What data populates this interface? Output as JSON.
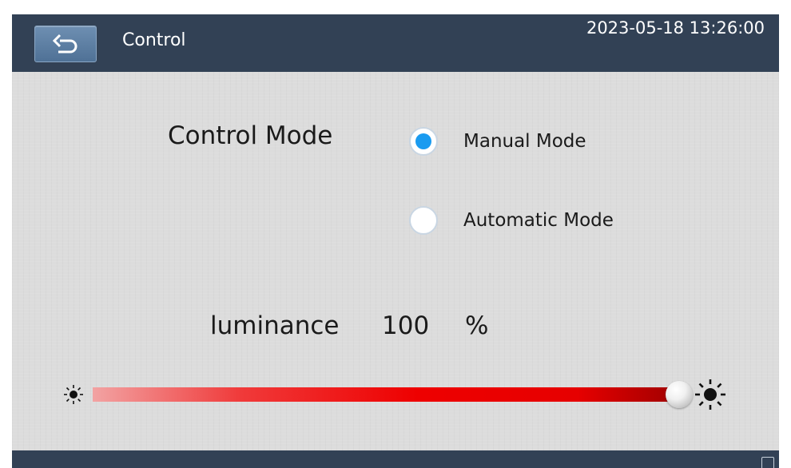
{
  "header": {
    "title": "Control",
    "datetime": "2023-05-18 13:26:00",
    "back_icon": "back-arrow-icon"
  },
  "control_mode": {
    "label": "Control Mode",
    "options": [
      {
        "label": "Manual Mode",
        "selected": true
      },
      {
        "label": "Automatic Mode",
        "selected": false
      }
    ]
  },
  "luminance": {
    "label": "luminance",
    "value": "100",
    "unit": "%",
    "level_percent": 100,
    "min_icon": "sun-small-icon",
    "max_icon": "sun-large-icon"
  },
  "colors": {
    "header_bg": "#324155",
    "radio_selected": "#1a9bf0",
    "slider_fill": "#ee0000"
  }
}
